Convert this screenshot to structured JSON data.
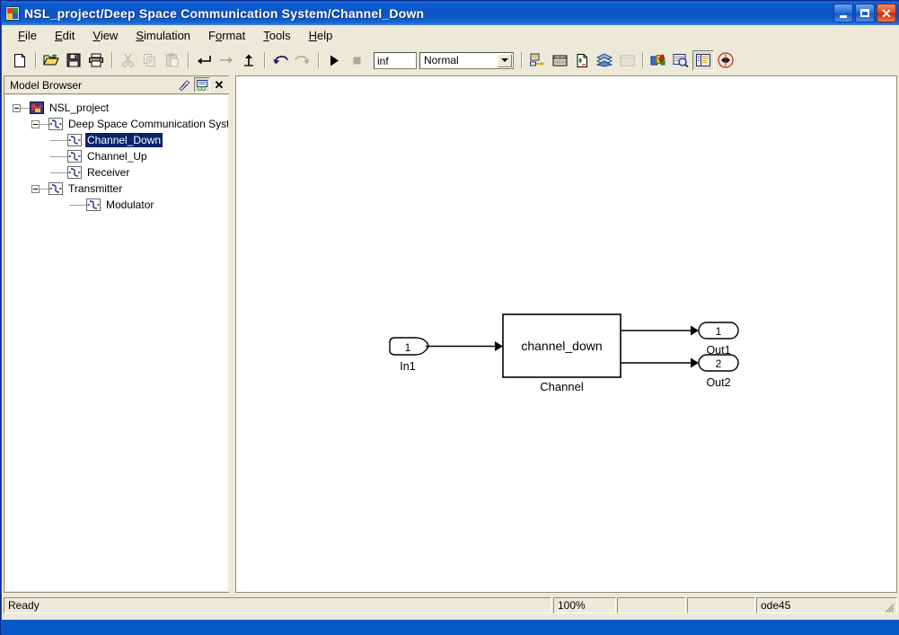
{
  "window": {
    "title": "NSL_project/Deep Space Communication System/Channel_Down",
    "icon": "simulink-model-icon",
    "minimize_label": "Minimize",
    "maximize_label": "Maximize",
    "close_label": "Close"
  },
  "menubar": {
    "items": [
      {
        "pre": "",
        "key": "F",
        "post": "ile"
      },
      {
        "pre": "",
        "key": "E",
        "post": "dit"
      },
      {
        "pre": "",
        "key": "V",
        "post": "iew"
      },
      {
        "pre": "",
        "key": "S",
        "post": "imulation"
      },
      {
        "pre": "F",
        "key": "o",
        "post": "rmat"
      },
      {
        "pre": "",
        "key": "T",
        "post": "ools"
      },
      {
        "pre": "",
        "key": "H",
        "post": "elp"
      }
    ]
  },
  "toolbar": {
    "buttons": [
      {
        "name": "new-model-button",
        "tip": "New model"
      },
      {
        "name": "open-model-button",
        "tip": "Open model"
      },
      {
        "name": "save-model-button",
        "tip": "Save model"
      },
      {
        "name": "print-button",
        "tip": "Print"
      },
      {
        "name": "cut-button",
        "tip": "Cut"
      },
      {
        "name": "copy-button",
        "tip": "Copy"
      },
      {
        "name": "paste-button",
        "tip": "Paste"
      },
      {
        "name": "go-to-parent-button",
        "tip": "Go to parent"
      },
      {
        "name": "forward-button",
        "tip": "Forward"
      },
      {
        "name": "up-level-button",
        "tip": "Up one level"
      },
      {
        "name": "undo-button",
        "tip": "Undo"
      },
      {
        "name": "redo-button",
        "tip": "Redo"
      },
      {
        "name": "start-simulation-button",
        "tip": "Start simulation"
      },
      {
        "name": "stop-simulation-button",
        "tip": "Stop simulation"
      },
      {
        "name": "update-diagram-button",
        "tip": "Update diagram"
      },
      {
        "name": "build-model-button",
        "tip": "Build model"
      },
      {
        "name": "debug-button",
        "tip": "Debug"
      },
      {
        "name": "library-browser-button",
        "tip": "Library Browser"
      },
      {
        "name": "toggle-model-browser-button",
        "tip": "Model Browser"
      },
      {
        "name": "block-parameters-button",
        "tip": "Block parameters"
      },
      {
        "name": "model-explorer-button",
        "tip": "Model Explorer"
      },
      {
        "name": "stateflow-button",
        "tip": "Stateflow"
      }
    ],
    "sim_time": {
      "label": "Simulation stop time",
      "value": "inf"
    },
    "sim_mode": {
      "label": "Simulation mode",
      "value": "Normal"
    }
  },
  "browser": {
    "title": "Model Browser",
    "tools": [
      {
        "name": "expand-tree-button",
        "tip": "Show library links"
      },
      {
        "name": "show-masked-subsystems-button",
        "tip": "Look under mask dialog"
      }
    ],
    "close_label": "✕",
    "tree": [
      {
        "label": "NSL_project",
        "depth": 0,
        "expanded": true,
        "icon": "model-icon",
        "selected": false
      },
      {
        "label": "Deep Space Communication System",
        "depth": 1,
        "expanded": true,
        "icon": "subsystem-icon",
        "selected": false
      },
      {
        "label": "Channel_Down",
        "depth": 2,
        "expanded": null,
        "icon": "subsystem-icon",
        "selected": true
      },
      {
        "label": "Channel_Up",
        "depth": 2,
        "expanded": null,
        "icon": "subsystem-icon",
        "selected": false
      },
      {
        "label": "Receiver",
        "depth": 2,
        "expanded": null,
        "icon": "subsystem-icon",
        "selected": false
      },
      {
        "label": "Transmitter",
        "depth": 2,
        "expanded": true,
        "icon": "subsystem-icon",
        "selected": false
      },
      {
        "label": "Modulator",
        "depth": 3,
        "expanded": null,
        "icon": "subsystem-icon",
        "selected": false
      }
    ]
  },
  "diagram": {
    "inports": [
      {
        "name": "inport-in1",
        "number": "1",
        "label": "In1"
      }
    ],
    "blocks": [
      {
        "name": "block-channel-down",
        "text": "channel_down",
        "caption": "Channel"
      }
    ],
    "outports": [
      {
        "name": "outport-out1",
        "number": "1",
        "label": "Out1"
      },
      {
        "name": "outport-out2",
        "number": "2",
        "label": "Out2"
      }
    ]
  },
  "statusbar": {
    "message": "Ready",
    "zoom": "100%",
    "pane3": "",
    "pane4": "",
    "solver": "ode45"
  }
}
